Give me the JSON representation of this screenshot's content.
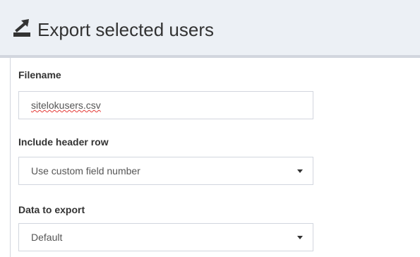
{
  "header": {
    "title": "Export selected users",
    "icon": "export-icon"
  },
  "form": {
    "filename": {
      "label": "Filename",
      "value": "sitelokusers.csv"
    },
    "header_row": {
      "label": "Include header row",
      "selected": "Use custom field number"
    },
    "data_to_export": {
      "label": "Data to export",
      "selected": "Default"
    }
  },
  "colors": {
    "header_bg": "#ecf0f5",
    "border": "#d2d6de",
    "text": "#333333"
  }
}
